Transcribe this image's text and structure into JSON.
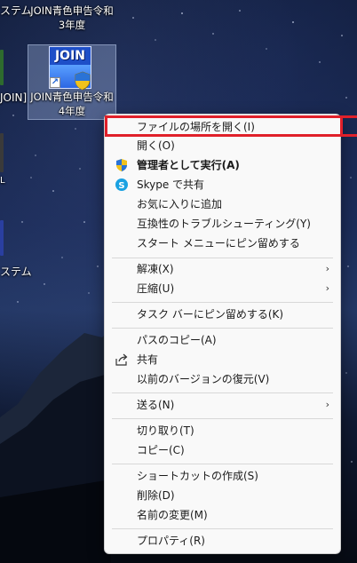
{
  "desktop": {
    "left_clipped": [
      {
        "text": "ステム"
      },
      {
        "text": "JOIN]"
      },
      {
        "text": "ステム"
      }
    ],
    "icons": [
      {
        "label_line1": "JOIN青色申告令和",
        "label_line2": "3年度"
      },
      {
        "label_line1": "JOIN青色申告令和",
        "label_line2": "4年度",
        "selected": true,
        "image_text": "JOIN"
      }
    ]
  },
  "context_menu": {
    "items": [
      {
        "label": "ファイルの場所を開く(I)",
        "highlighted": true
      },
      {
        "label": "開く(O)"
      },
      {
        "label": "管理者として実行(A)",
        "icon": "uac-shield-icon",
        "bold": true
      },
      {
        "label": "Skype で共有",
        "icon": "skype-icon"
      },
      {
        "label": "お気に入りに追加"
      },
      {
        "label": "互換性のトラブルシューティング(Y)"
      },
      {
        "label": "スタート メニューにピン留めする"
      },
      {
        "label": "解凍(X)",
        "submenu": true
      },
      {
        "label": "圧縮(U)",
        "submenu": true
      },
      {
        "label": "タスク バーにピン留めする(K)"
      },
      {
        "label": "パスのコピー(A)"
      },
      {
        "label": "共有",
        "icon": "share-icon"
      },
      {
        "label": "以前のバージョンの復元(V)"
      },
      {
        "label": "送る(N)",
        "submenu": true
      },
      {
        "label": "切り取り(T)"
      },
      {
        "label": "コピー(C)"
      },
      {
        "label": "ショートカットの作成(S)"
      },
      {
        "label": "削除(D)"
      },
      {
        "label": "名前の変更(M)"
      },
      {
        "label": "プロパティ(R)"
      }
    ],
    "submenu_glyph": "›",
    "highlight_color": "#e0202a"
  }
}
